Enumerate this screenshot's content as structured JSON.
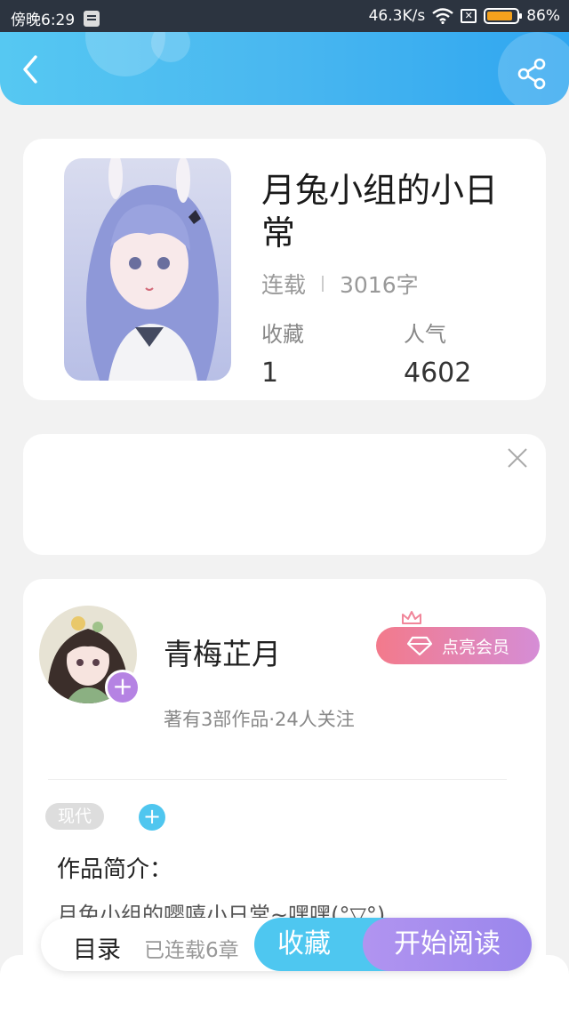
{
  "status_bar": {
    "time": "傍晚6:29",
    "speed": "46.3K/s",
    "battery": "86%",
    "battery_level": 0.86,
    "battery_color": "#f4a11d"
  },
  "header": {
    "back_icon": "chevron-left-icon",
    "share_icon": "share-icon",
    "gradient": [
      "#56c8f2",
      "#2fa6f0"
    ]
  },
  "book": {
    "title": "月兔小组的小日常",
    "status": "连载",
    "word_count": "3016字",
    "stats": [
      {
        "label": "收藏",
        "value": "1"
      },
      {
        "label": "人气",
        "value": "4602"
      }
    ]
  },
  "ad": {
    "close_icon": "close-icon"
  },
  "author": {
    "name": "青梅芷月",
    "stats": "著有3部作品·24人关注",
    "vip_label": "点亮会员",
    "vip_gradient": [
      "#f37a8b",
      "#d58dd6"
    ]
  },
  "tags": [
    "现代"
  ],
  "intro": {
    "heading": "作品简介：",
    "text": "月兔小组的嘤嘻小日常~嘿嘿(°▽°)"
  },
  "bottom_bar": {
    "toc_label": "目录",
    "chapter_count": "已连载6章",
    "collect_label": "收藏",
    "read_label": "开始阅读",
    "collect_color": "#4ec7f0",
    "read_color": "#a58eee"
  }
}
